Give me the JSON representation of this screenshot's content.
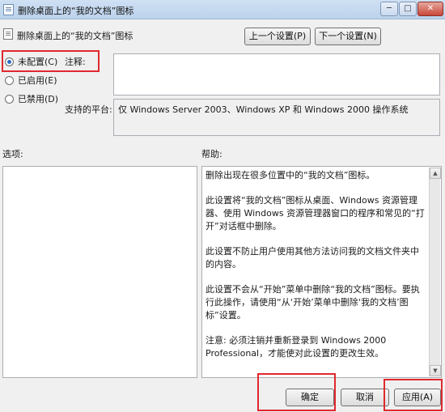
{
  "window": {
    "title": "删除桌面上的“我的文档”图标",
    "minimize": "─",
    "maximize": "□",
    "close": "✕"
  },
  "header": {
    "policy_name": "删除桌面上的“我的文档”图标",
    "prev_button": "上一个设置(P)",
    "next_button": "下一个设置(N)"
  },
  "state_options": [
    {
      "label": "未配置(C)",
      "selected": true
    },
    {
      "label": "已启用(E)",
      "selected": false
    },
    {
      "label": "已禁用(D)",
      "selected": false
    }
  ],
  "comment": {
    "label": "注释:",
    "value": ""
  },
  "supported": {
    "label": "支持的平台:",
    "value": "仅 Windows Server 2003、Windows XP 和 Windows 2000 操作系统"
  },
  "options": {
    "label": "选项:"
  },
  "help": {
    "label": "帮助:",
    "paragraphs": [
      "删除出现在很多位置中的“我的文档”图标。",
      "此设置将“我的文档”图标从桌面、Windows 资源管理器、使用 Windows 资源管理器窗口的程序和常见的“打开”对话框中删除。",
      "此设置不防止用户使用其他方法访问我的文档文件夹中的内容。",
      "此设置不会从“开始”菜单中删除“我的文档”图标。要执行此操作，请使用“从‘开始’菜单中删除‘我的文档’图标”设置。",
      "注意: 必须注销并重新登录到 Windows 2000 Professional，才能使对此设置的更改生效。"
    ]
  },
  "footer": {
    "ok": "确定",
    "cancel": "取消",
    "apply": "应用(A)"
  },
  "colors": {
    "highlight": "#e0282e",
    "radio_selected": "#2a6bc6"
  }
}
